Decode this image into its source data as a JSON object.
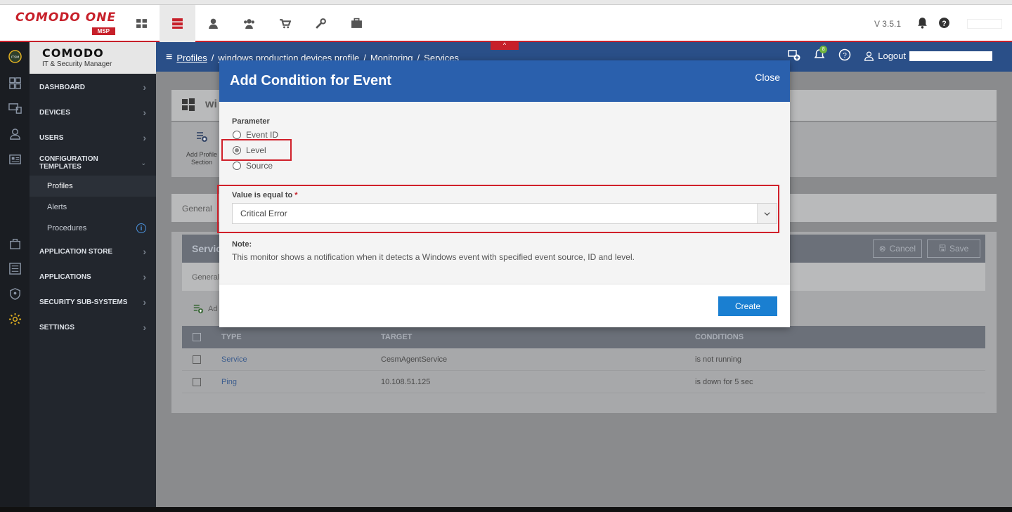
{
  "brand": {
    "name": "COMODO ONE",
    "tag": "MSP"
  },
  "top_nav": {
    "version": "V 3.5.1",
    "items": [
      "dashboard-grid-icon",
      "servers-icon",
      "user-icon",
      "users-icon",
      "cart-icon",
      "wrench-icon",
      "briefcase-icon"
    ]
  },
  "sidebar": {
    "logo_title": "COMODO",
    "logo_sub": "IT & Security Manager",
    "items": {
      "dashboard": "DASHBOARD",
      "devices": "DEVICES",
      "users": "USERS",
      "config": "CONFIGURATION TEMPLATES",
      "profiles": "Profiles",
      "alerts": "Alerts",
      "procedures": "Procedures",
      "app_store": "APPLICATION STORE",
      "applications": "APPLICATIONS",
      "security": "SECURITY SUB-SYSTEMS",
      "settings": "SETTINGS"
    },
    "chevron": "›",
    "info": "i"
  },
  "header": {
    "menu_icon": "≡",
    "breadcrumb": [
      "Profiles",
      "windows production devices profile",
      "Monitoring",
      "Services"
    ],
    "sep": "/",
    "logout": "Logout",
    "collapse": "^",
    "notif_count": "8"
  },
  "page": {
    "profile_title_partial": "wi",
    "add_profile_section": "Add Profile Section",
    "general_tab": "General",
    "services_header_partial": "Servic",
    "general_sub": "General",
    "add_partial": "Ad",
    "cancel": "Cancel",
    "save": "Save"
  },
  "table": {
    "headers": [
      "TYPE",
      "TARGET",
      "CONDITIONS"
    ],
    "rows": [
      {
        "type": "Service",
        "target": "CesmAgentService",
        "condition": "is not running"
      },
      {
        "type": "Ping",
        "target": "10.108.51.125",
        "condition": "is down for 5 sec"
      }
    ]
  },
  "modal": {
    "title": "Add Condition for Event",
    "close": "Close",
    "parameter_label": "Parameter",
    "options": [
      "Event ID",
      "Level",
      "Source"
    ],
    "selected_option": "Level",
    "value_label": "Value is equal to",
    "required": "*",
    "value": "Critical Error",
    "note_label": "Note:",
    "note_text": "This monitor shows a notification when it detects a Windows event with specified event source, ID and level.",
    "create": "Create"
  },
  "colors": {
    "brand_red": "#c7202a",
    "header_blue": "#2a4f88",
    "modal_blue": "#2a60ad",
    "button_blue": "#1a7fd1"
  }
}
